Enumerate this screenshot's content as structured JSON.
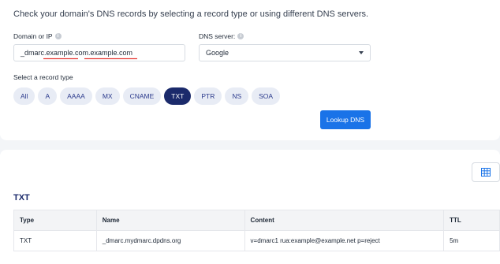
{
  "intro": "Check your domain's DNS records by selecting a record type or using different DNS servers.",
  "domain_label": "Domain or IP",
  "domain_value": "_dmarc.example.com.example.com",
  "dns_label": "DNS server:",
  "dns_value": "Google",
  "record_type_label": "Select a record type",
  "record_types": [
    "All",
    "A",
    "AAAA",
    "MX",
    "CNAME",
    "TXT",
    "PTR",
    "NS",
    "SOA"
  ],
  "selected_record_type": "TXT",
  "lookup_label": "Lookup DNS",
  "result_title": "TXT",
  "table": {
    "headers": [
      "Type",
      "Name",
      "Content",
      "TTL"
    ],
    "rows": [
      [
        "TXT",
        "_dmarc.mydmarc.dpdns.org",
        "v=dmarc1 rua:example@example.net p=reject",
        "5m"
      ]
    ]
  },
  "colors": {
    "accent": "#1a73e8",
    "selected_pill": "#1b2a6b",
    "pill": "#e8ecf5",
    "spellcheck": "#e53935"
  },
  "icons": {
    "info": "info-icon",
    "caret": "chevron-down-icon",
    "grid": "table-grid-icon"
  }
}
